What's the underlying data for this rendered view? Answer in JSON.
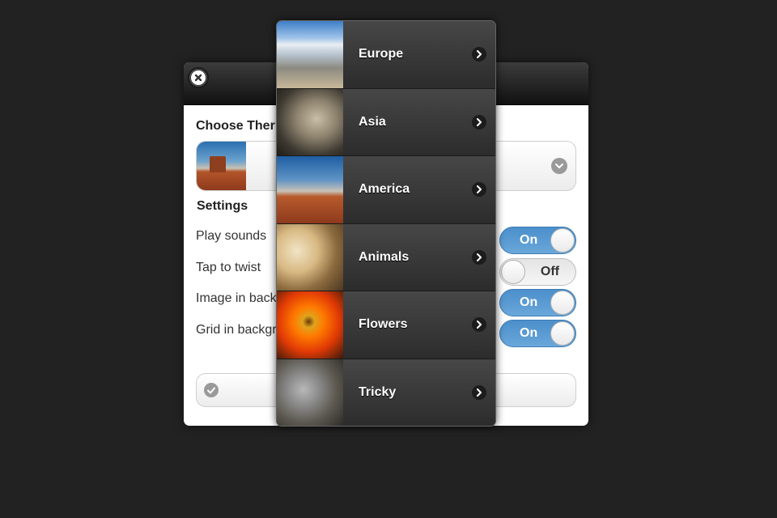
{
  "dialog": {
    "close_icon": "close-icon",
    "theme_section_title": "Choose Ther",
    "theme_selected_icon": "america-thumbnail",
    "settings_title": "Settings",
    "settings": [
      {
        "label": "Play sounds",
        "state": "On"
      },
      {
        "label": "Tap to twist",
        "state": "Off"
      },
      {
        "label": "Image in backg",
        "state": "On"
      },
      {
        "label": "Grid in backgr",
        "state": "On"
      }
    ],
    "ok_icon": "check-icon"
  },
  "menu": {
    "items": [
      {
        "label": "Europe",
        "thumb": "europe-thumbnail"
      },
      {
        "label": "Asia",
        "thumb": "asia-thumbnail"
      },
      {
        "label": "America",
        "thumb": "america-thumbnail"
      },
      {
        "label": "Animals",
        "thumb": "animals-thumbnail"
      },
      {
        "label": "Flowers",
        "thumb": "flowers-thumbnail"
      },
      {
        "label": "Tricky",
        "thumb": "tricky-thumbnail"
      }
    ]
  },
  "colors": {
    "background": "#222222",
    "toggle_on": "#5b9bd5",
    "menu_bg": "#2e2e2e"
  }
}
